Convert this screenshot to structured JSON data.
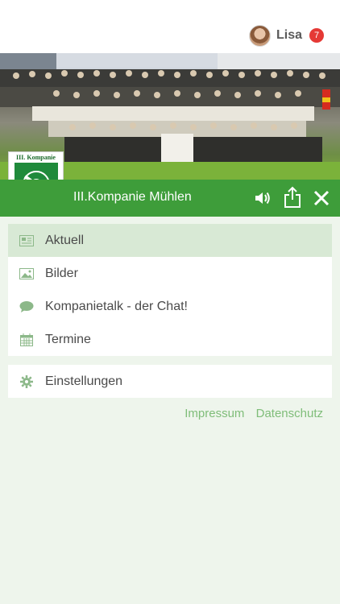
{
  "user": {
    "name": "Lisa",
    "notifications": "7"
  },
  "company": {
    "name": "III.Kompanie Mühlen",
    "crest_text": "III. Kompanie"
  },
  "menu": [
    {
      "label": "Aktuell",
      "icon": "newspaper-icon",
      "active": true
    },
    {
      "label": "Bilder",
      "icon": "image-icon",
      "active": false
    },
    {
      "label": "Kompanietalk - der Chat!",
      "icon": "chat-icon",
      "active": false
    },
    {
      "label": "Termine",
      "icon": "calendar-icon",
      "active": false
    }
  ],
  "settings": {
    "label": "Einstellungen",
    "icon": "gear-icon"
  },
  "footer": {
    "impressum": "Impressum",
    "datenschutz": "Datenschutz"
  },
  "colors": {
    "green": "#3e9d3a",
    "active_bg": "#d8e9d5",
    "link": "#7fbd79",
    "badge": "#e53935"
  }
}
